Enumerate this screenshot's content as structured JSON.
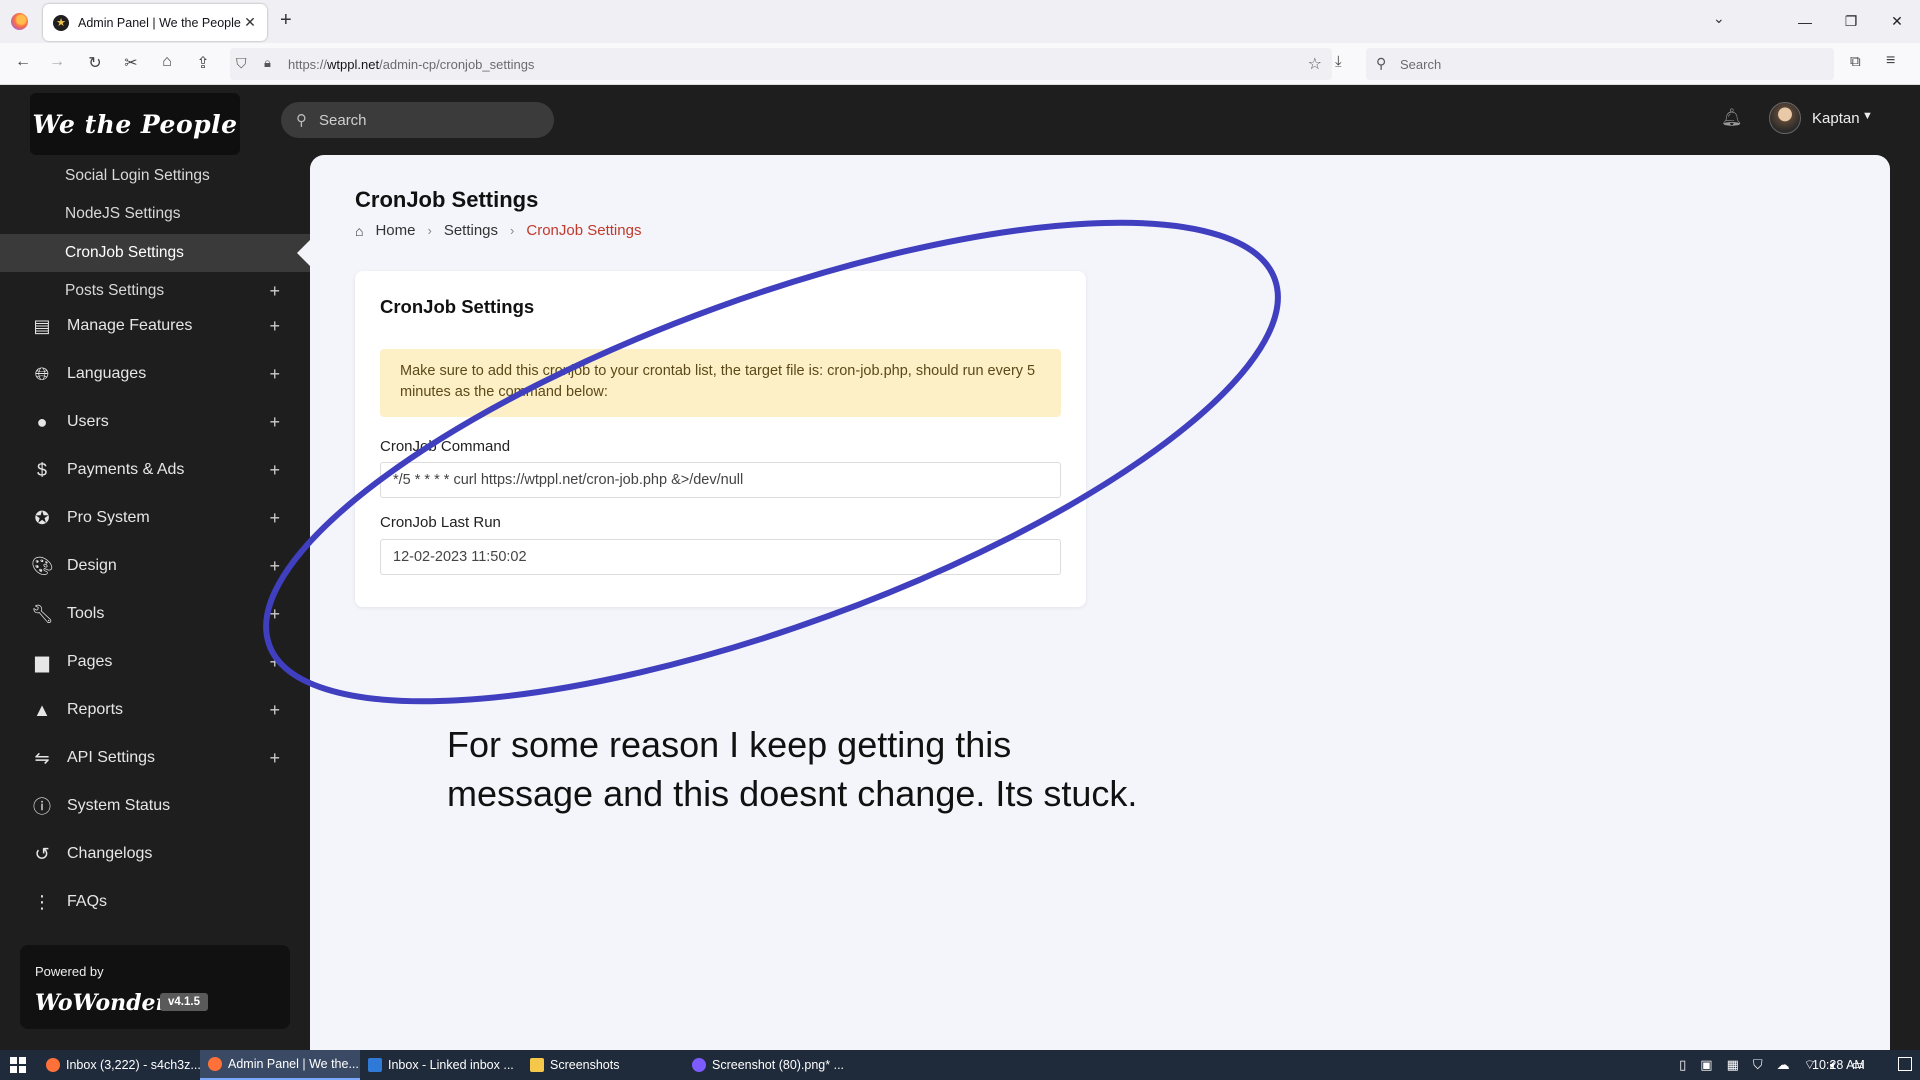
{
  "browser": {
    "tab_title": "Admin Panel | We the People",
    "url_prefix": "https://",
    "url_host": "wtppl.net",
    "url_path": "/admin-cp/cronjob_settings",
    "search_placeholder": "Search"
  },
  "header": {
    "logo_text": "We the People",
    "search_placeholder": "Search",
    "user_name": "Kaptan"
  },
  "sidebar": {
    "sub_items": [
      {
        "label": "Social Login Settings"
      },
      {
        "label": "NodeJS Settings"
      },
      {
        "label": "CronJob Settings"
      },
      {
        "label": "Posts Settings"
      }
    ],
    "items": [
      {
        "label": "Manage Features",
        "icon": "layers-icon"
      },
      {
        "label": "Languages",
        "icon": "globe-icon"
      },
      {
        "label": "Users",
        "icon": "user-icon"
      },
      {
        "label": "Payments & Ads",
        "icon": "dollar-icon"
      },
      {
        "label": "Pro System",
        "icon": "star-icon"
      },
      {
        "label": "Design",
        "icon": "palette-icon"
      },
      {
        "label": "Tools",
        "icon": "wrench-icon"
      },
      {
        "label": "Pages",
        "icon": "page-icon"
      },
      {
        "label": "Reports",
        "icon": "warning-icon"
      },
      {
        "label": "API Settings",
        "icon": "api-icon"
      },
      {
        "label": "System Status",
        "icon": "info-icon"
      },
      {
        "label": "Changelogs",
        "icon": "history-icon"
      },
      {
        "label": "FAQs",
        "icon": "dots-icon"
      }
    ],
    "powered_by": "Powered by",
    "brand": "WoWonder",
    "version": "v4.1.5"
  },
  "main": {
    "title": "CronJob Settings",
    "breadcrumb": [
      "Home",
      "Settings",
      "CronJob Settings"
    ],
    "card": {
      "title": "CronJob Settings",
      "alert": "Make sure to add this cronjob to your crontab list, the target file is: cron-job.php, should run every 5 minutes as the command below:",
      "command_label": "CronJob Command",
      "command_value": "*/5 * * * * curl https://wtppl.net/cron-job.php &>/dev/null",
      "last_run_label": "CronJob Last Run",
      "last_run_value": "12-02-2023 11:50:02"
    }
  },
  "annotation": {
    "line1": "For some reason I keep getting this",
    "line2": "message and this doesnt change. Its stuck.",
    "color": "#3f3fbf"
  },
  "taskbar": {
    "tasks": [
      {
        "label": "Inbox (3,222) - s4ch3z..."
      },
      {
        "label": "Admin Panel | We the..."
      },
      {
        "label": "Inbox - Linked inbox ..."
      },
      {
        "label": "Screenshots"
      },
      {
        "label": "Screenshot (80).png* ..."
      }
    ],
    "clock": "10:28 AM"
  },
  "colors": {
    "sidebar_bg": "#1e1e1e",
    "content_bg": "#f4f5fb",
    "breadcrumb_active": "#c0392b",
    "alert_bg": "#fdf0c6"
  }
}
